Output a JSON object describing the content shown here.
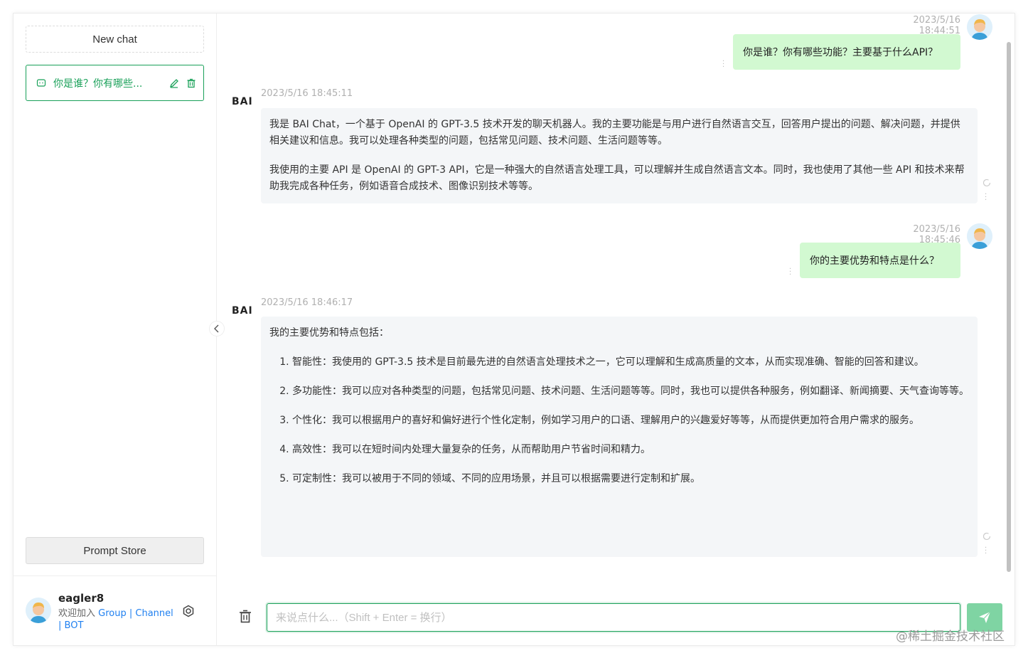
{
  "sidebar": {
    "new_chat_label": "New chat",
    "conversations": [
      {
        "title": "你是谁？你有哪些..."
      }
    ],
    "prompt_store_label": "Prompt Store",
    "user": {
      "name": "eagler8",
      "desc_prefix": "欢迎加入 ",
      "link_group": "Group",
      "sep1": " | ",
      "link_channel": "Channel",
      "sep2": " | ",
      "link_bot": "BOT"
    }
  },
  "messages": [
    {
      "role": "user",
      "time": "2023/5/16 18:44:51",
      "text": "你是谁？你有哪些功能？主要基于什么API？"
    },
    {
      "role": "bot",
      "time": "2023/5/16 18:45:11",
      "paragraphs": [
        "我是 BAI Chat，一个基于 OpenAI 的 GPT-3.5 技术开发的聊天机器人。我的主要功能是与用户进行自然语言交互，回答用户提出的问题、解决问题，并提供相关建议和信息。我可以处理各种类型的问题，包括常见问题、技术问题、生活问题等等。",
        "我使用的主要 API 是 OpenAI 的 GPT-3 API，它是一种强大的自然语言处理工具，可以理解并生成自然语言文本。同时，我也使用了其他一些 API 和技术来帮助我完成各种任务，例如语音合成技术、图像识别技术等等。"
      ]
    },
    {
      "role": "user",
      "time": "2023/5/16 18:45:46",
      "text": "你的主要优势和特点是什么？"
    },
    {
      "role": "bot",
      "time": "2023/5/16 18:46:17",
      "intro": "我的主要优势和特点包括：",
      "items": [
        "智能性：我使用的 GPT-3.5 技术是目前最先进的自然语言处理技术之一，它可以理解和生成高质量的文本，从而实现准确、智能的回答和建议。",
        "多功能性：我可以应对各种类型的问题，包括常见问题、技术问题、生活问题等等。同时，我也可以提供各种服务，例如翻译、新闻摘要、天气查询等等。",
        "个性化：我可以根据用户的喜好和偏好进行个性化定制，例如学习用户的口语、理解用户的兴趣爱好等等，从而提供更加符合用户需求的服务。",
        "高效性：我可以在短时间内处理大量复杂的任务，从而帮助用户节省时间和精力。",
        "可定制性：我可以被用于不同的领域、不同的应用场景，并且可以根据需要进行定制和扩展。"
      ]
    }
  ],
  "bot_logo": "BAI",
  "input": {
    "placeholder": "来说点什么...（Shift + Enter = 换行）",
    "value": ""
  },
  "watermark": "@稀土掘金技术社区",
  "colors": {
    "accent": "#18a058",
    "user_bubble": "#d2f9d1",
    "bot_bubble": "#f4f6f8",
    "link": "#2080f0"
  },
  "icons": [
    "chat-bubble-icon",
    "edit-icon",
    "delete-icon",
    "gear-icon",
    "chevron-left-icon",
    "trash-icon",
    "send-icon",
    "refresh-icon",
    "more-dots-icon"
  ]
}
